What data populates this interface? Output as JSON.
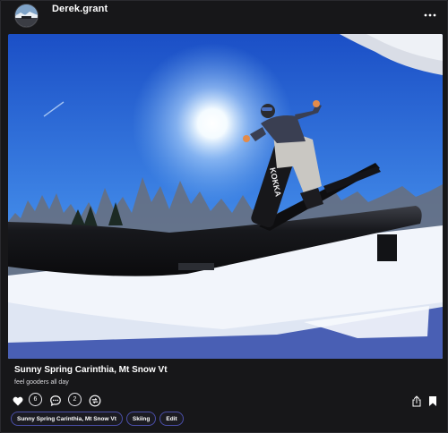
{
  "post": {
    "username": "Derek.grant",
    "title": "Sunny Spring Carinthia, Mt Snow Vt",
    "caption": "feel gooders all day"
  },
  "actions": {
    "likes_count": "6",
    "comments_count": "2"
  },
  "tags": [
    "Sunny Spring Carinthia, Mt Snow Vt",
    "Skiing",
    "Edit"
  ],
  "icons": {
    "more": "more-horizontal-icon",
    "like": "heart-icon",
    "comment": "speech-bubble-icon",
    "repost": "repost-icon",
    "share": "share-icon",
    "bookmark": "bookmark-icon"
  },
  "colors": {
    "background": "#171719",
    "tag_border": "#4a4ea8",
    "text": "#ffffff"
  }
}
